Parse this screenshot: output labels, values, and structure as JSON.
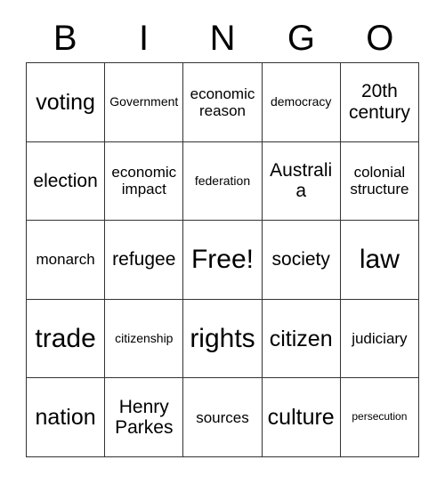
{
  "card": {
    "title": "BINGO",
    "header_letters": [
      "B",
      "I",
      "N",
      "G",
      "O"
    ],
    "free_space_label": "Free!",
    "colors": {
      "border": "#333333",
      "background": "#ffffff",
      "text": "#000000"
    },
    "grid": {
      "rows": 5,
      "columns": 5,
      "cells": [
        [
          {
            "label": "voting",
            "size": "fs-xl"
          },
          {
            "label": "Government",
            "size": "fs-sm"
          },
          {
            "label": "economic reason",
            "size": "fs-md"
          },
          {
            "label": "democracy",
            "size": "fs-sm"
          },
          {
            "label": "20th century",
            "size": "fs-lg"
          }
        ],
        [
          {
            "label": "election",
            "size": "fs-lg"
          },
          {
            "label": "economic impact",
            "size": "fs-md"
          },
          {
            "label": "federation",
            "size": "fs-sm"
          },
          {
            "label": "Australia",
            "size": "fs-lg"
          },
          {
            "label": "colonial structure",
            "size": "fs-md"
          }
        ],
        [
          {
            "label": "monarch",
            "size": "fs-md"
          },
          {
            "label": "refugee",
            "size": "fs-lg"
          },
          {
            "label": "Free!",
            "size": "fs-xxl"
          },
          {
            "label": "society",
            "size": "fs-lg"
          },
          {
            "label": "law",
            "size": "fs-xxl"
          }
        ],
        [
          {
            "label": "trade",
            "size": "fs-xxl"
          },
          {
            "label": "citizenship",
            "size": "fs-sm"
          },
          {
            "label": "rights",
            "size": "fs-xxl"
          },
          {
            "label": "citizen",
            "size": "fs-xl"
          },
          {
            "label": "judiciary",
            "size": "fs-md"
          }
        ],
        [
          {
            "label": "nation",
            "size": "fs-xl"
          },
          {
            "label": "Henry Parkes",
            "size": "fs-lg"
          },
          {
            "label": "sources",
            "size": "fs-md"
          },
          {
            "label": "culture",
            "size": "fs-xl"
          },
          {
            "label": "persecution",
            "size": "fs-xs"
          }
        ]
      ]
    }
  }
}
